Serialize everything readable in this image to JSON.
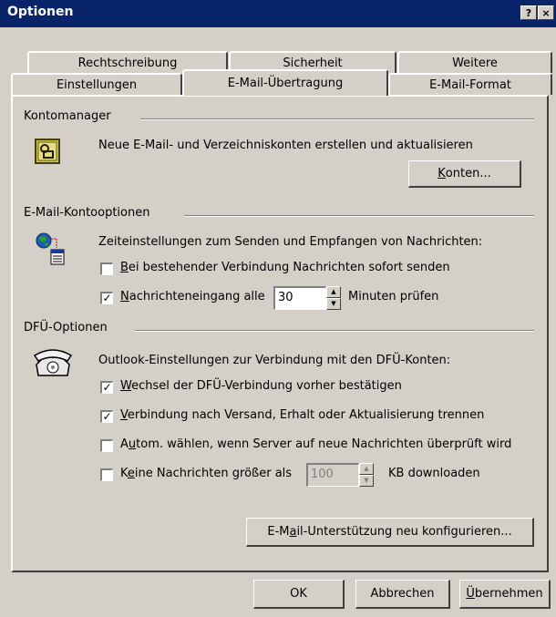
{
  "window": {
    "title": "Optionen",
    "help_btn": "?",
    "close_btn": "×"
  },
  "tabs": {
    "row1": [
      "Rechtschreibung",
      "Sicherheit",
      "Weitere"
    ],
    "row2": [
      "Einstellungen",
      "E-Mail-Übertragung",
      "E-Mail-Format"
    ],
    "active": "E-Mail-Übertragung"
  },
  "kontomanager": {
    "title": "Kontomanager",
    "description": "Neue E-Mail- und Verzeichniskonten erstellen und aktualisieren",
    "button_ul": "K",
    "button_rest": "onten..."
  },
  "kontooptionen": {
    "title": "E-Mail-Kontooptionen",
    "description": "Zeiteinstellungen zum Senden und Empfangen von Nachrichten:",
    "send_ul": "B",
    "send_rest": "ei bestehender Verbindung Nachrichten sofort senden",
    "send_checked": false,
    "receive_ul": "N",
    "receive_rest": "achrichteneingang alle",
    "receive_checked": true,
    "receive_value": "30",
    "receive_suffix": "Minuten prüfen"
  },
  "dfu": {
    "title": "DFÜ-Optionen",
    "description": "Outlook-Einstellungen zur Verbindung mit den DFÜ-Konten:",
    "opt1_ul": "W",
    "opt1_rest": "echsel der DFÜ-Verbindung vorher bestätigen",
    "opt1_checked": true,
    "opt2_ul": "V",
    "opt2_rest": "erbindung nach Versand, Erhalt oder Aktualisierung trennen",
    "opt2_checked": true,
    "opt3_pre": "A",
    "opt3_ul": "u",
    "opt3_rest": "tom. wählen, wenn Server auf neue Nachrichten überprüft wird",
    "opt3_checked": false,
    "opt4_pre": "K",
    "opt4_ul": "e",
    "opt4_rest": "ine Nachrichten größer als",
    "opt4_checked": false,
    "opt4_value": "100",
    "opt4_suffix": "KB downloaden"
  },
  "reconfigure": {
    "pre": "E-M",
    "ul": "a",
    "rest": "il-Unterstützung neu konfigurieren..."
  },
  "footer": {
    "ok": "OK",
    "cancel": "Abbrechen",
    "apply_ul": "Ü",
    "apply_rest": "bernehmen"
  }
}
